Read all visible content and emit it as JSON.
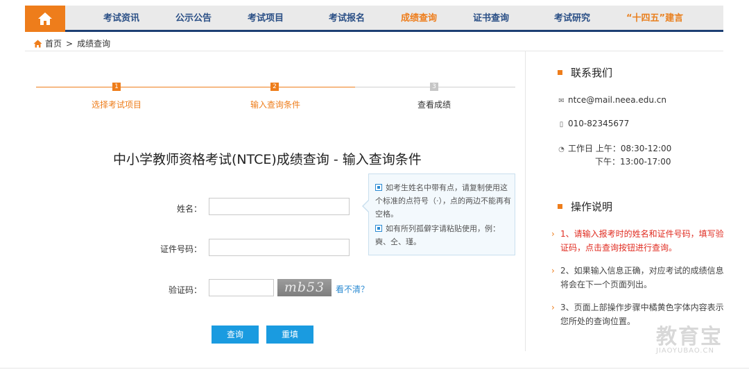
{
  "colors": {
    "accent": "#ee7d1b",
    "nav_text": "#2a4f86",
    "nav_border": "#1d3f73",
    "button": "#1a9be0",
    "link": "#2a8ad2",
    "alert": "#e02b20"
  },
  "nav": {
    "home_icon": "home-icon",
    "items": [
      {
        "label": "考试资讯"
      },
      {
        "label": "公示公告"
      },
      {
        "label": "考试项目"
      },
      {
        "label": "考试报名"
      },
      {
        "label": "成绩查询"
      },
      {
        "label": "证书查询"
      },
      {
        "label": "考试研究"
      },
      {
        "label": "“十四五”建言"
      }
    ]
  },
  "breadcrumb": {
    "home": "首页",
    "separator": ">",
    "current": "成绩查询"
  },
  "steps": [
    {
      "num": "1",
      "label": "选择考试项目"
    },
    {
      "num": "2",
      "label": "输入查询条件"
    },
    {
      "num": "3",
      "label": "查看成绩"
    }
  ],
  "form": {
    "title": "中小学教师资格考试(NTCE)成绩查询 - 输入查询条件",
    "name_label": "姓名：",
    "name_value": "",
    "id_label": "证件号码：",
    "id_value": "",
    "captcha_label": "验证码：",
    "captcha_value": "",
    "captcha_text": "mb53",
    "refresh_link": "看不清？",
    "submit": "查询",
    "reset": "重填"
  },
  "tip": {
    "line1": "如考生姓名中带有点，请复制使用这个标准的点符号（·），点的两边不能再有空格。",
    "line2": "如有所列孤僻字请粘贴使用，例：奭、仝、瑾。"
  },
  "sidebar": {
    "contact_title": "联系我们",
    "email": "ntce@mail.neea.edu.cn",
    "phone": "010-82345677",
    "hours_label": "工作日 上午：08:30-12:00",
    "hours_pm": "下午：13:00-17:00",
    "instructions_title": "操作说明",
    "instructions": [
      "1、请输入报考时的姓名和证件号码，填写验证码，点击查询按钮进行查询。",
      "2、如果输入信息正确，对应考试的成绩信息将会在下一个页面列出。",
      "3、页面上部操作步骤中橘黄色字体内容表示您所处的查询位置。"
    ]
  },
  "watermark": {
    "cn": "教育宝",
    "en": "JIAOYUBAO.CN"
  }
}
